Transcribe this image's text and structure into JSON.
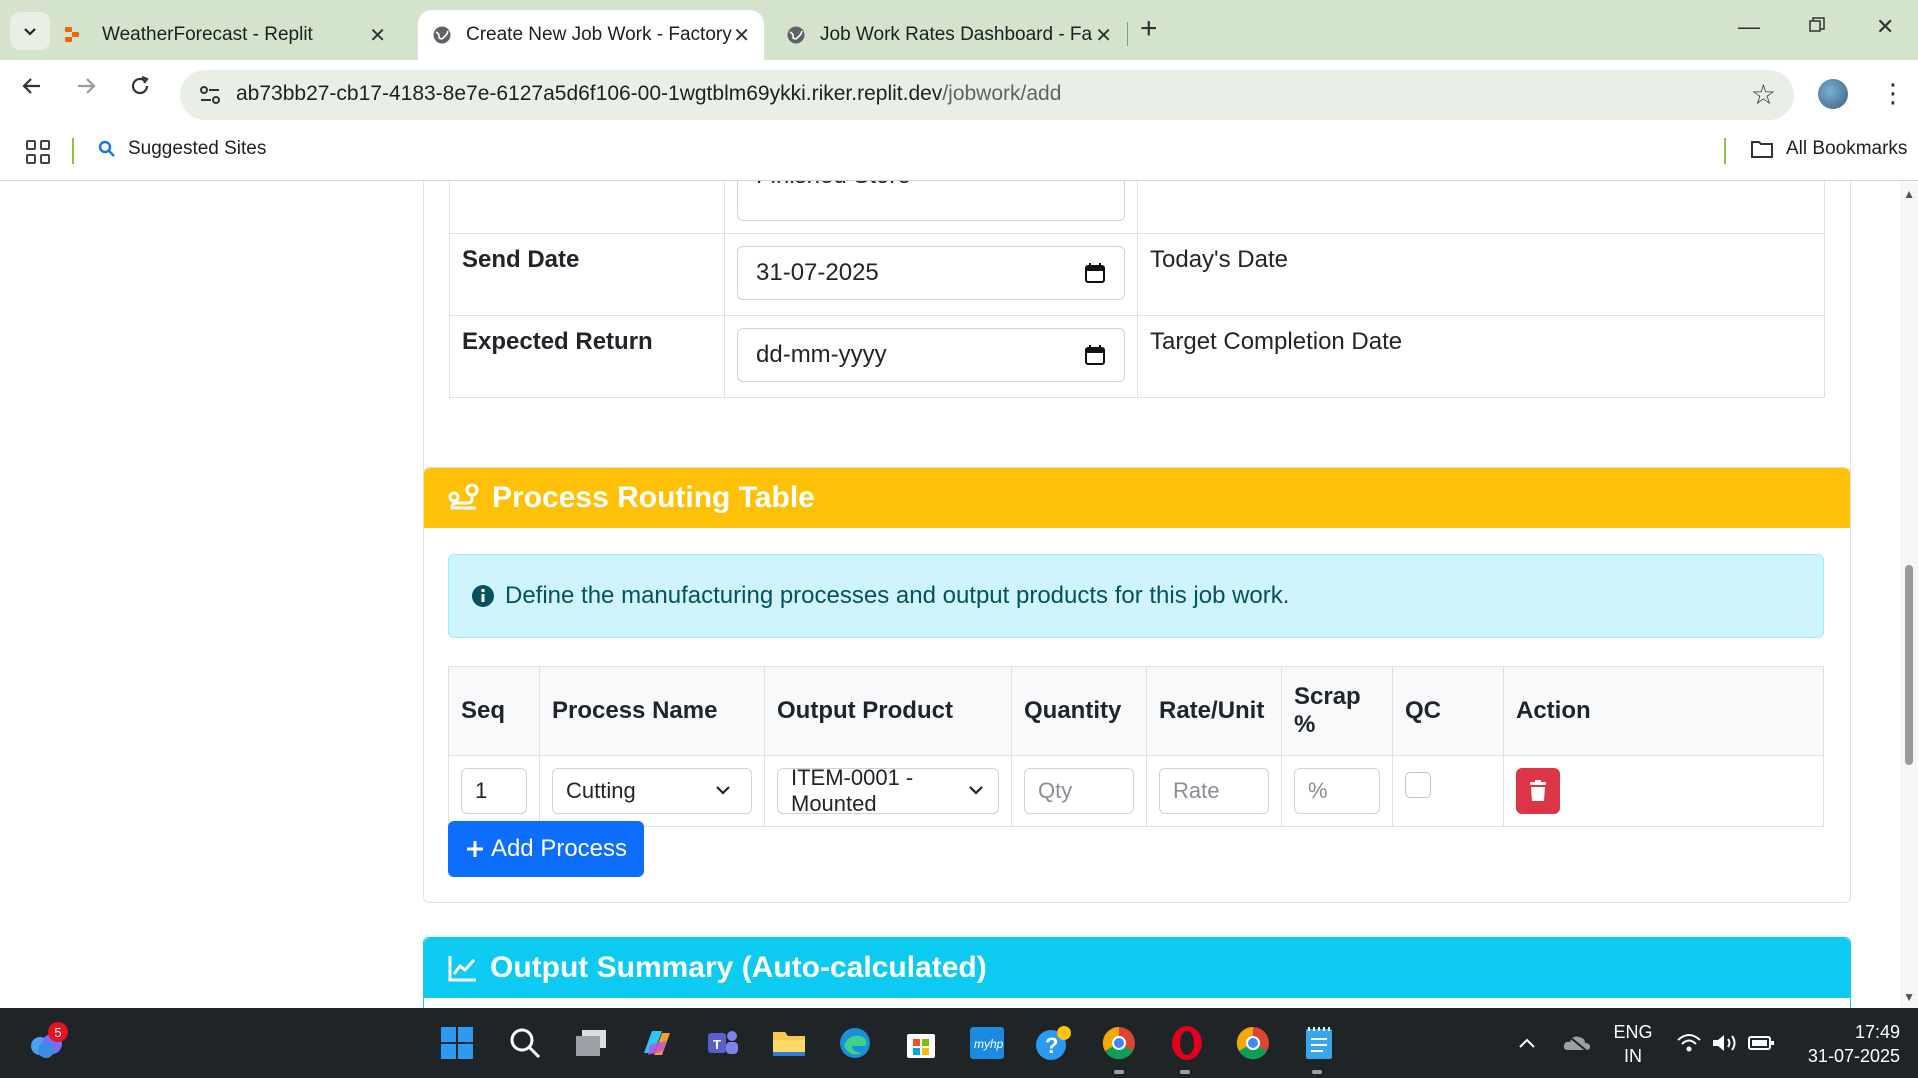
{
  "browser": {
    "tabs": [
      {
        "title": "WeatherForecast - Replit",
        "active": false
      },
      {
        "title": "Create New Job Work - Factory",
        "active": true
      },
      {
        "title": "Job Work Rates Dashboard - Fa",
        "active": false
      }
    ],
    "url_domain": "ab73bb27-cb17-4183-8e7e-6127a5d6f106-00-1wgtblm69ykki.riker.replit.dev",
    "url_path": "/jobwork/add",
    "bookmarks": {
      "suggested": "Suggested Sites",
      "all": "All Bookmarks"
    }
  },
  "form": {
    "partial_store_value": "Finished Store",
    "rows": [
      {
        "label": "Send Date",
        "value": "31-07-2025",
        "hint": "Today's Date"
      },
      {
        "label": "Expected Return",
        "value": "dd-mm-yyyy",
        "hint": "Target Completion Date"
      }
    ]
  },
  "routing": {
    "title": "Process Routing Table",
    "header_color": "#ffc107",
    "info_text": "Define the manufacturing processes and output products for this job work.",
    "columns": [
      "Seq",
      "Process Name",
      "Output Product",
      "Quantity",
      "Rate/Unit",
      "Scrap %",
      "QC",
      "Action"
    ],
    "row": {
      "seq": "1",
      "process": "Cutting",
      "product": "ITEM-0001 - Mounted",
      "qty_placeholder": "Qty",
      "rate_placeholder": "Rate",
      "scrap_placeholder": "%"
    },
    "add_button": "Add Process"
  },
  "summary": {
    "title": "Output Summary (Auto-calculated)",
    "header_color": "#0dcaf0"
  },
  "taskbar": {
    "notification_count": "5",
    "lang": "ENG",
    "region": "IN",
    "time": "17:49",
    "date": "31-07-2025"
  }
}
